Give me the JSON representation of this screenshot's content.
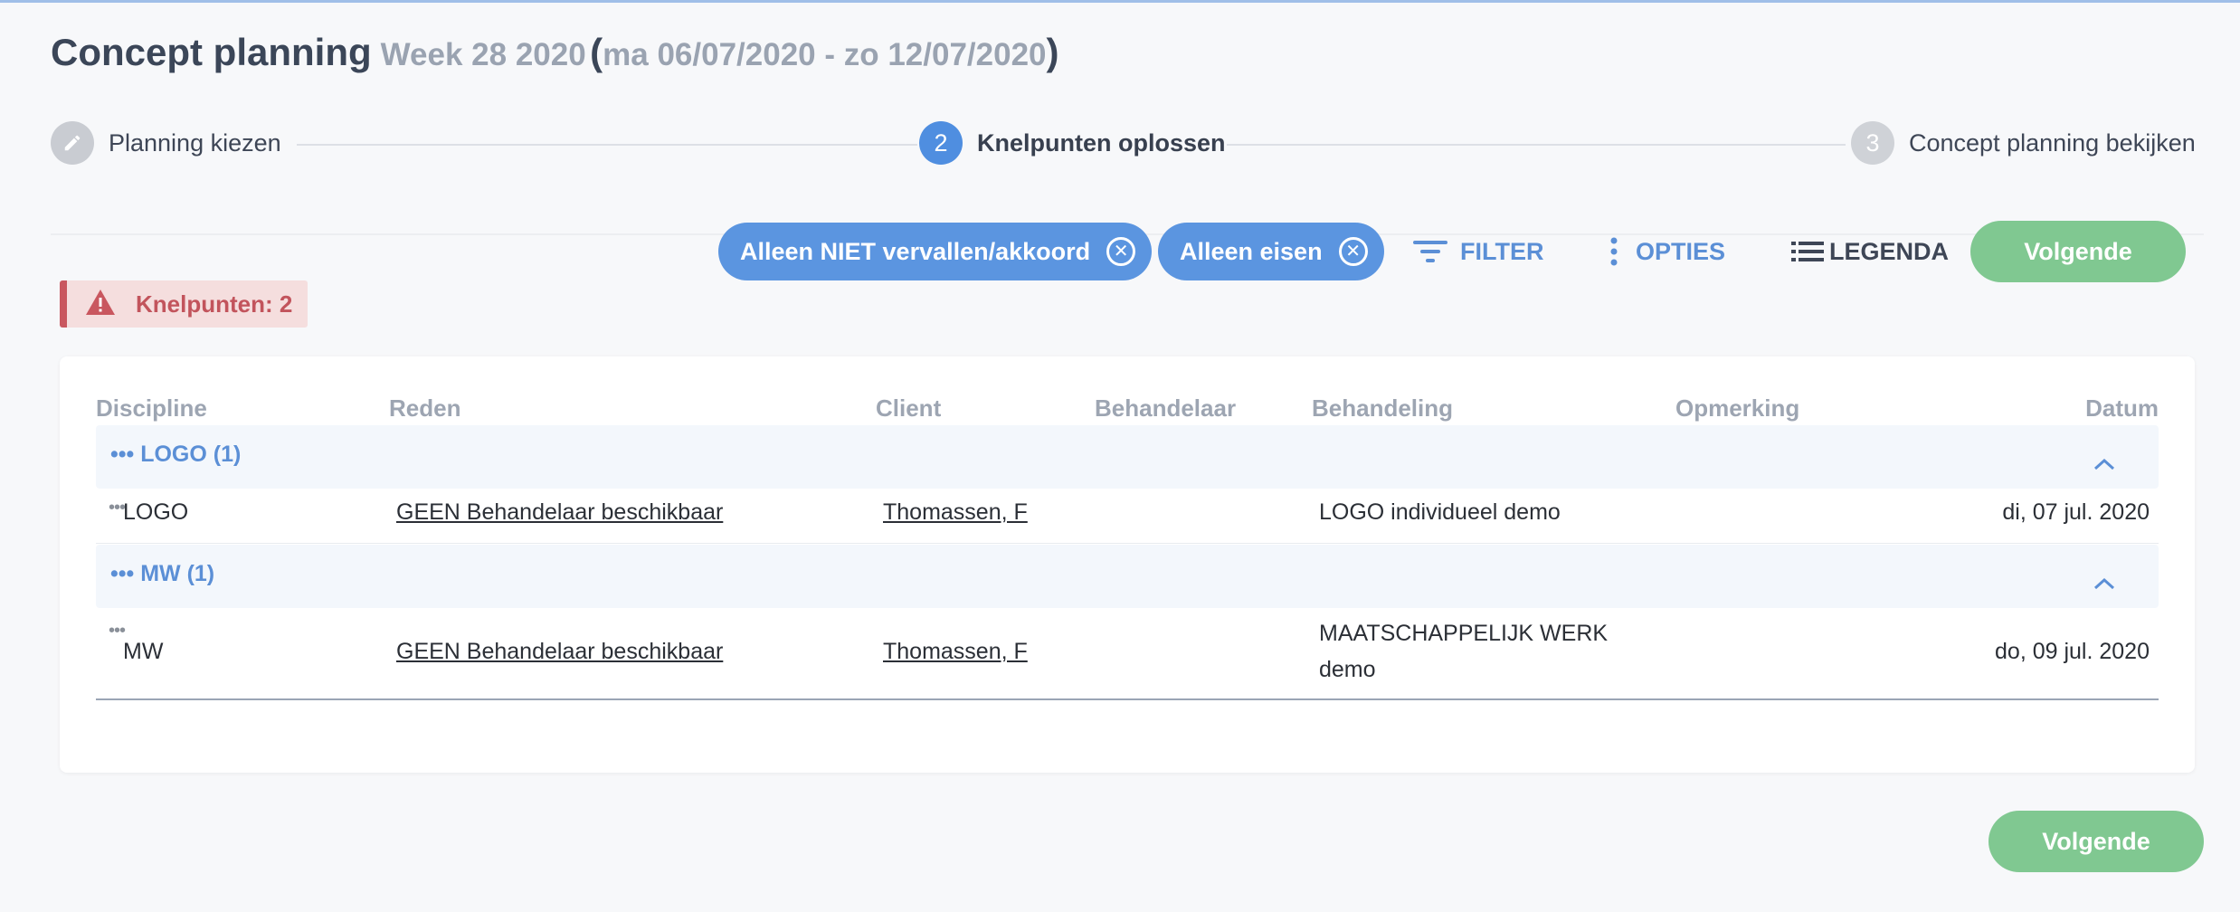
{
  "header": {
    "title": "Concept planning",
    "week": "Week 28 2020",
    "paren_open": "(",
    "range": "ma 06/07/2020 - zo 12/07/2020",
    "paren_close": ")"
  },
  "stepper": {
    "steps": [
      {
        "label": "Planning kiezen",
        "icon": "pencil-icon",
        "state": "done"
      },
      {
        "number": "2",
        "label": "Knelpunten oplossen",
        "state": "active"
      },
      {
        "number": "3",
        "label": "Concept planning bekijken",
        "state": "todo"
      }
    ]
  },
  "toolbar": {
    "chips": [
      {
        "label": "Alleen NIET vervallen/akkoord"
      },
      {
        "label": "Alleen eisen"
      }
    ],
    "filter_label": "FILTER",
    "options_label": "OPTIES",
    "legend_label": "LEGENDA",
    "next_label": "Volgende"
  },
  "alert": {
    "label": "Knelpunten: 2"
  },
  "table": {
    "columns": [
      "Discipline",
      "Reden",
      "Client",
      "Behandelaar",
      "Behandeling",
      "Opmerking",
      "Datum"
    ],
    "groups": [
      {
        "label": "LOGO (1)",
        "rows": [
          {
            "discipline": "LOGO",
            "reden": "GEEN Behandelaar beschikbaar",
            "client": "Thomassen, F",
            "behandelaar": "",
            "behandeling_line1": "LOGO individueel demo",
            "behandeling_line2": "",
            "opmerking": "",
            "datum": "di, 07 jul. 2020"
          }
        ]
      },
      {
        "label": "MW (1)",
        "rows": [
          {
            "discipline": "MW",
            "reden": "GEEN Behandelaar beschikbaar",
            "client": "Thomassen, F",
            "behandelaar": "",
            "behandeling_line1": "MAATSCHAPPELIJK WERK",
            "behandeling_line2": "demo",
            "opmerking": "",
            "datum": "do, 09 jul. 2020"
          }
        ]
      }
    ]
  },
  "footer": {
    "next_label": "Volgende"
  },
  "colors": {
    "accent_blue": "#5b95e0",
    "success_green": "#80c891",
    "alert_red": "#c9575f"
  }
}
